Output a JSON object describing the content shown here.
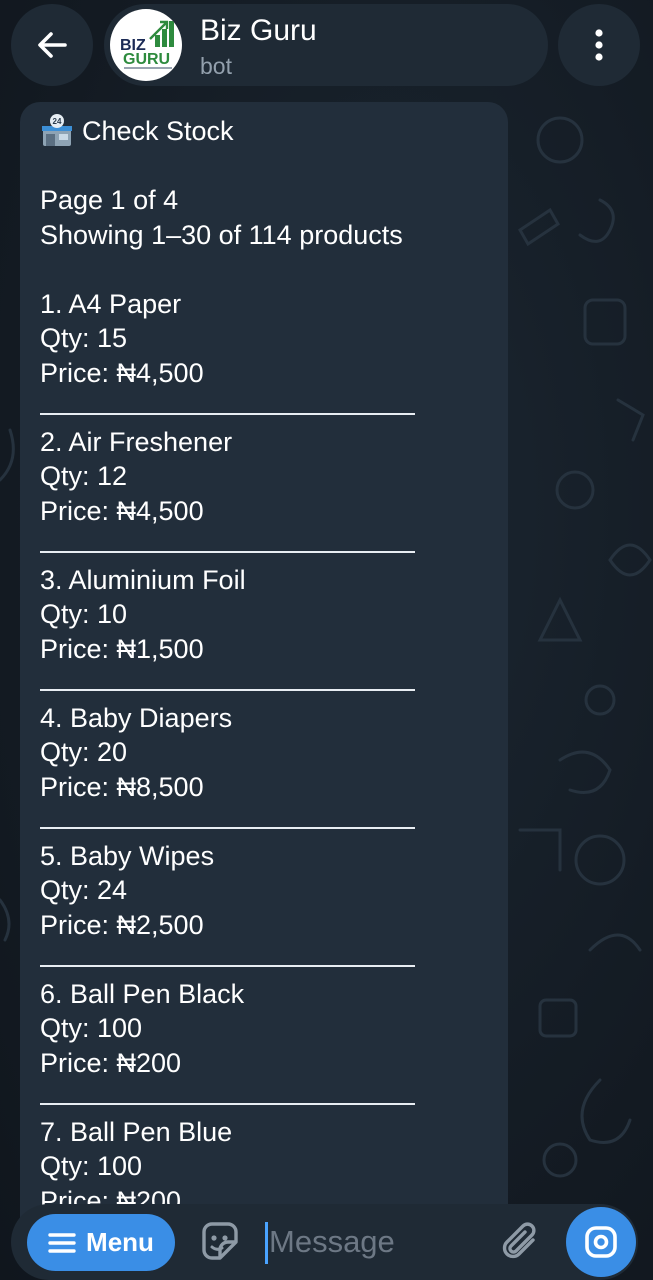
{
  "header": {
    "bot_name": "Biz Guru",
    "bot_status": "bot",
    "avatar_text_top": "BIZ",
    "avatar_text_bottom": "GURU"
  },
  "message": {
    "title": "Check Stock",
    "page_info": "Page 1 of 4",
    "showing": "Showing 1–30 of 114 products",
    "products": [
      {
        "name": "1. A4 Paper",
        "qty": "Qty: 15",
        "price": "Price: ₦4,500"
      },
      {
        "name": "2. Air Freshener",
        "qty": "Qty: 12",
        "price": "Price: ₦4,500"
      },
      {
        "name": "3. Aluminium Foil",
        "qty": "Qty: 10",
        "price": "Price: ₦1,500"
      },
      {
        "name": "4. Baby Diapers",
        "qty": "Qty: 20",
        "price": "Price: ₦8,500"
      },
      {
        "name": "5. Baby Wipes",
        "qty": "Qty: 24",
        "price": "Price: ₦2,500"
      },
      {
        "name": "6. Ball Pen Black",
        "qty": "Qty: 100",
        "price": "Price: ₦200"
      },
      {
        "name": "7. Ball Pen Blue",
        "qty": "Qty: 100",
        "price": "Price: ₦200"
      }
    ]
  },
  "composer": {
    "menu_label": "Menu",
    "placeholder": "Message"
  },
  "colors": {
    "accent": "#3a8ee6",
    "bubble": "#222e3b",
    "chrome": "#1f2a35",
    "background": "#141c25"
  },
  "icons": [
    "back-arrow-icon",
    "more-vertical-icon",
    "store-24-icon",
    "menu-lines-icon",
    "sticker-icon",
    "paperclip-icon",
    "camera-icon"
  ]
}
